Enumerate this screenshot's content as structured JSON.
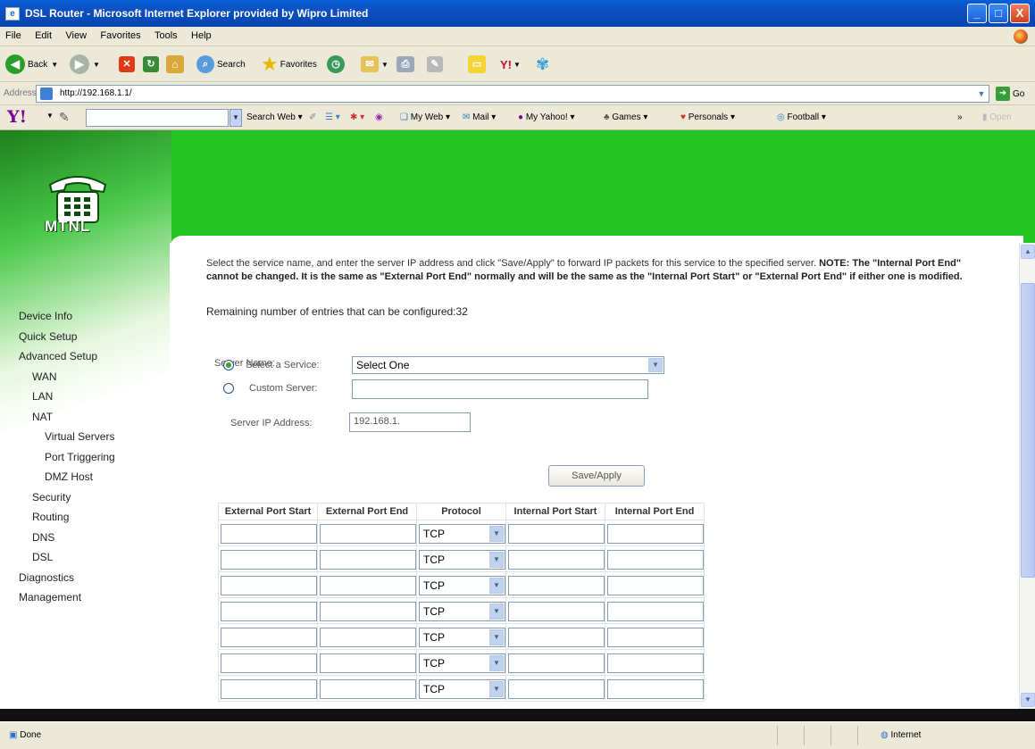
{
  "window": {
    "title": "DSL Router - Microsoft Internet Explorer provided by Wipro Limited",
    "controls": [
      "_",
      "□",
      "X"
    ]
  },
  "menu": [
    "File",
    "Edit",
    "View",
    "Favorites",
    "Tools",
    "Help"
  ],
  "toolbar": {
    "back_label": "Back",
    "search_label": "Search",
    "favorites_label": "Favorites"
  },
  "address": {
    "label": "Address",
    "url": "http://192.168.1.1/",
    "go_label": "Go"
  },
  "yahoo": {
    "logo": "Y!",
    "search_web": "Search Web",
    "items": [
      "My Web",
      "Mail",
      "My Yahoo!",
      "Games",
      "Personals",
      "Football"
    ],
    "more": "»"
  },
  "brand": {
    "name": "MTNL"
  },
  "nav": {
    "items": [
      {
        "label": "Device Info"
      },
      {
        "label": "Quick Setup"
      },
      {
        "label": "Advanced Setup"
      },
      {
        "label": "WAN"
      },
      {
        "label": "LAN"
      },
      {
        "label": "NAT"
      },
      {
        "label": "Virtual Servers"
      },
      {
        "label": "Port Triggering"
      },
      {
        "label": "DMZ Host"
      },
      {
        "label": "Security"
      },
      {
        "label": "Routing"
      },
      {
        "label": "DNS"
      },
      {
        "label": "DSL"
      },
      {
        "label": "Diagnostics"
      },
      {
        "label": "Management"
      }
    ]
  },
  "main": {
    "description": "Select the service name, and enter the server IP address and click \"Save/Apply\" to forward IP packets for this service to the specified server.",
    "note_label": "NOTE:",
    "note_text": "The \"Internal Port End\" cannot be changed. It is the same as \"External Port End\" normally and will be the same as the \"Internal Port Start\" or \"External Port End\" if either one is modified.",
    "remaining": "Remaining number of entries that can be configured:32",
    "server_name_label": "Server Name:",
    "select_service_label": "Select a Service:",
    "select_service_value": "Select One",
    "custom_server_label": "Custom Server:",
    "custom_server_value": "",
    "server_ip_label": "Server IP Address:",
    "server_ip_value": "192.168.1.",
    "save_apply_label": "Save/Apply",
    "table": {
      "headers": [
        "External Port Start",
        "External Port End",
        "Protocol",
        "Internal Port Start",
        "Internal Port End"
      ],
      "rows": [
        {
          "protocol": "TCP"
        },
        {
          "protocol": "TCP"
        },
        {
          "protocol": "TCP"
        },
        {
          "protocol": "TCP"
        },
        {
          "protocol": "TCP"
        },
        {
          "protocol": "TCP"
        },
        {
          "protocol": "TCP"
        }
      ]
    }
  },
  "status": {
    "left": "Done",
    "zone": "Internet"
  }
}
